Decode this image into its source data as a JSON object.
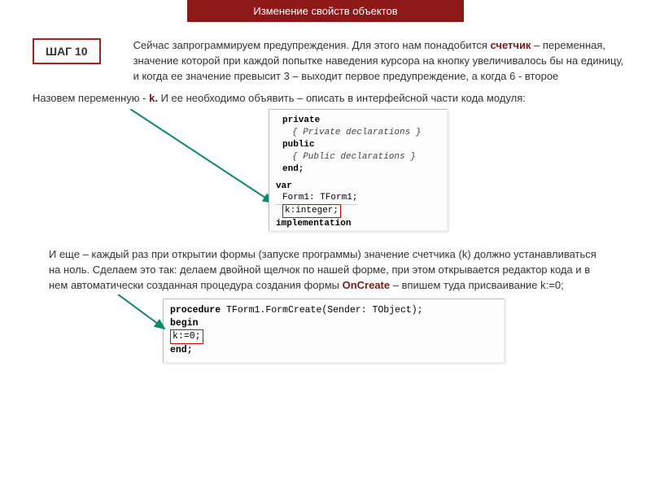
{
  "header": {
    "title": "Изменение свойств объектов"
  },
  "step": {
    "label": "ШАГ 10",
    "text_pre": "Сейчас запрограммируем предупреждения. Для этого нам понадобится ",
    "counter_word": "счетчик",
    "text_post": " – переменная, значение которой при каждой попытке наведения курсора на кнопку увеличивалось бы на единицу, и когда ее значение превысит 3 – выходит первое предупреждение, а когда 6 - второе"
  },
  "para1": {
    "pre": "Назовем переменную  - ",
    "k": "k.",
    "post": " И ее необходимо объявить – описать в интерфейсной части кода модуля:"
  },
  "code1": {
    "l1": "private",
    "l2": "{ Private declarations }",
    "l3": "public",
    "l4": "{ Public declarations }",
    "l5": "end;",
    "l6": "var",
    "l7": "Form1: TForm1;",
    "l8": "k:integer;",
    "l9": "implementation"
  },
  "para2": {
    "pre": "И еще – каждый раз при открытии формы (запуске программы) значение счетчика (k) должно устанавливаться на ноль. Сделаем это так: делаем двойной щелчок по нашей форме, при этом открывается редактор кода и в нем автоматически созданная процедура создания формы ",
    "oncreate": "OnCreate",
    "post": " – впишем туда присваивание k:=0;"
  },
  "code2": {
    "l1a": "procedure",
    "l1b": " TForm1.FormCreate(Sender: TObject);",
    "l2": "begin",
    "l3": "k:=0;",
    "l4": "end;"
  }
}
